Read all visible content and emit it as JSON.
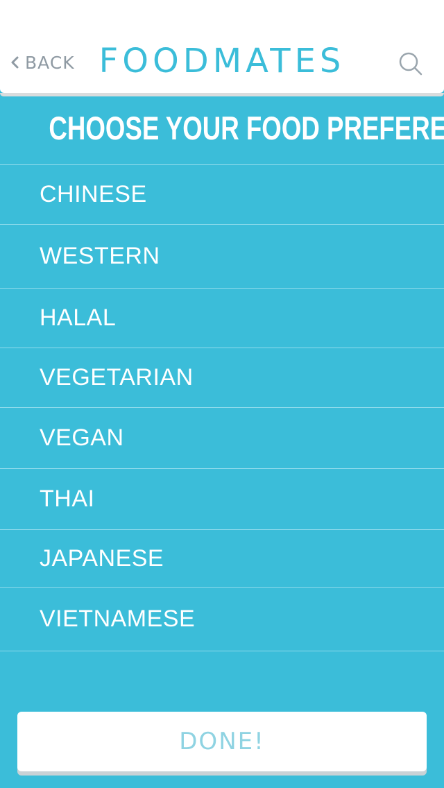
{
  "header": {
    "back_label": "BACK",
    "title": "FOODMATES",
    "back_icon": "chevron-left-icon",
    "search_icon": "search-icon"
  },
  "main": {
    "section_title": "CHOOSE YOUR FOOD PREFERENCES",
    "preferences": [
      {
        "label": "CHINESE"
      },
      {
        "label": "WESTERN"
      },
      {
        "label": "HALAL"
      },
      {
        "label": "VEGETARIAN"
      },
      {
        "label": "VEGAN"
      },
      {
        "label": "THAI"
      },
      {
        "label": "JAPANESE"
      },
      {
        "label": "VIETNAMESE"
      }
    ]
  },
  "footer": {
    "done_label": "DONE!"
  },
  "colors": {
    "accent": "#3bbdd9",
    "header_bg": "#ffffff",
    "muted_gray": "#8f9aa3",
    "done_text": "#8fd3e2"
  }
}
